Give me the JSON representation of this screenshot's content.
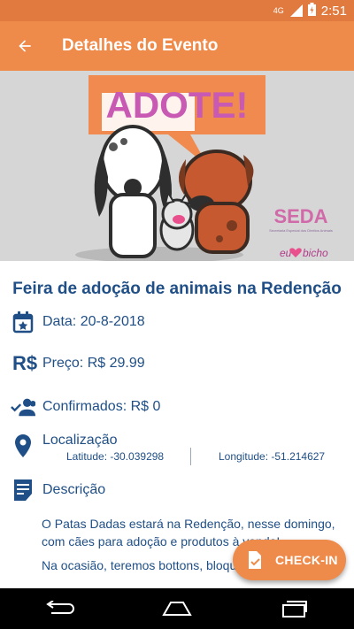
{
  "status_bar": {
    "network": "4G",
    "time": "2:51"
  },
  "app_bar": {
    "title": "Detalhes do Evento",
    "back_icon": "arrow-back-icon"
  },
  "banner": {
    "headline": "ADOTE!",
    "logo_text": "SEDA",
    "logo_subtext": "Secretaria Especial dos Direitos Animais",
    "slogan_prefix": "eu",
    "slogan_suffix": "bicho"
  },
  "event": {
    "title": "Feira de adoção de animais na Redenção",
    "date": "Data: 20-8-2018",
    "price_symbol": "R$",
    "price": "Preço: R$ 29.99",
    "confirmed": "Confirmados: R$ 0",
    "location_label": "Localização",
    "latitude": "Latitude: -30.039298",
    "longitude": "Longitude: -51.214627",
    "description_label": "Descrição",
    "description_p1": "O Patas Dadas estará na Redenção, nesse domingo, com cães para adoção e produtos à venda!",
    "description_p2": "Na ocasião, teremos bottons, bloqueadores..."
  },
  "fab": {
    "label": "CHECK-IN",
    "icon": "check-in-icon"
  },
  "colors": {
    "primary": "#ef8b4a",
    "status": "#e07a3e",
    "text": "#1f4f86"
  }
}
